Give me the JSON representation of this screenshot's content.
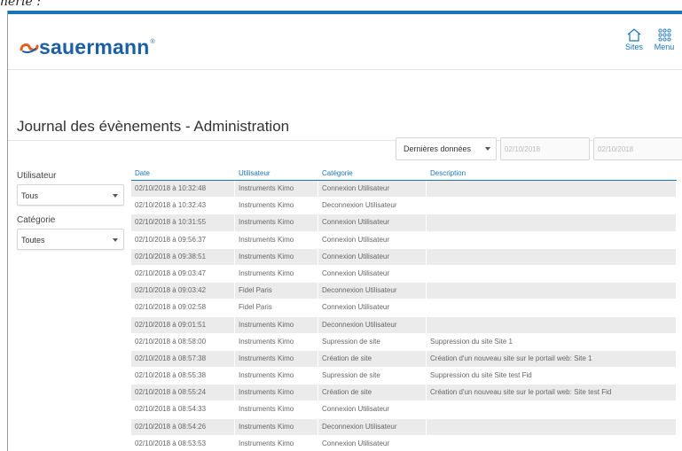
{
  "doc": {
    "caption": "nerie :"
  },
  "header": {
    "logo": "sauermann",
    "sites_label": "Sites",
    "menu_label": "Menu"
  },
  "page": {
    "title": "Journal des évènements - Administration"
  },
  "filters": {
    "period": {
      "value": "Dernières données"
    },
    "date_from": {
      "placeholder": "02/10/2018"
    },
    "date_to": {
      "placeholder": "02/10/2018"
    }
  },
  "sidebar": {
    "user_label": "Utilisateur",
    "user_value": "Tous",
    "category_label": "Catégorie",
    "category_value": "Toutes"
  },
  "table": {
    "columns": [
      "Date",
      "Utilisateur",
      "Catégorie",
      "Description"
    ],
    "rows": [
      [
        "02/10/2018 à 10:32:48",
        "Instruments Kimo",
        "Connexion Utilisateur",
        ""
      ],
      [
        "02/10/2018 à 10:32:43",
        "Instruments Kimo",
        "Deconnexion Utilisateur",
        ""
      ],
      [
        "02/10/2018 à 10:31:55",
        "Instruments Kimo",
        "Connexion Utilisateur",
        ""
      ],
      [
        "02/10/2018 à 09:56:37",
        "Instruments Kimo",
        "Connexion Utilisateur",
        ""
      ],
      [
        "02/10/2018 à 09:38:51",
        "Instruments Kimo",
        "Connexion Utilisateur",
        ""
      ],
      [
        "02/10/2018 à 09:03:47",
        "Instruments Kimo",
        "Connexion Utilisateur",
        ""
      ],
      [
        "02/10/2018 à 09:03:42",
        "Fidel Paris",
        "Deconnexion Utilisateur",
        ""
      ],
      [
        "02/10/2018 à 09:02:58",
        "Fidel Paris",
        "Connexion Utilisateur",
        ""
      ],
      [
        "02/10/2018 à 09:01:51",
        "Instruments Kimo",
        "Deconnexion Utilisateur",
        ""
      ],
      [
        "02/10/2018 à 08:58:00",
        "Instruments Kimo",
        "Supression de site",
        "Suppression du site Site 1"
      ],
      [
        "02/10/2018 à 08:57:38",
        "Instruments Kimo",
        "Création de site",
        "Création d'un nouveau site sur le portail web: Site 1"
      ],
      [
        "02/10/2018 à 08:55:38",
        "Instruments Kimo",
        "Supression de site",
        "Suppression du site Site test Fid"
      ],
      [
        "02/10/2018 à 08:55:24",
        "Instruments Kimo",
        "Création de site",
        "Création d'un nouveau site sur le portail web: Site test Fid"
      ],
      [
        "02/10/2018 à 08:54:33",
        "Instruments Kimo",
        "Connexion Utilisateur",
        ""
      ],
      [
        "02/10/2018 à 08:54:26",
        "Instruments Kimo",
        "Deconnexion Utilisateur",
        ""
      ],
      [
        "02/10/2018 à 08:53:53",
        "Instruments Kimo",
        "Connexion Utilisateur",
        ""
      ]
    ]
  },
  "colors": {
    "accent": "#1a74b8",
    "logo": "#1b5fa6",
    "logo_mark": "#e85a1e",
    "row_stripe": "#ebebeb"
  }
}
